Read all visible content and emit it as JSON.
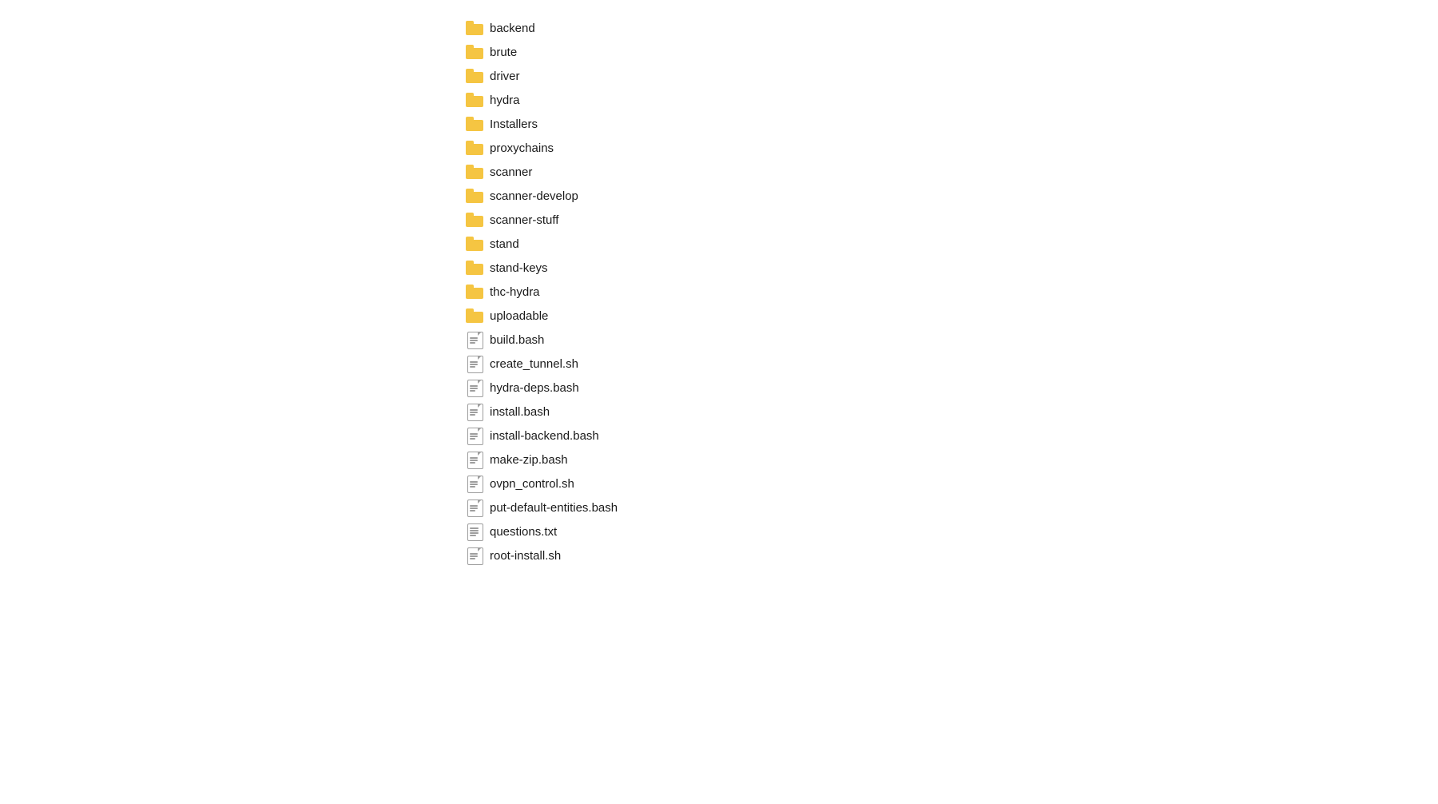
{
  "fileList": {
    "items": [
      {
        "name": "backend",
        "type": "folder"
      },
      {
        "name": "brute",
        "type": "folder"
      },
      {
        "name": "driver",
        "type": "folder"
      },
      {
        "name": "hydra",
        "type": "folder"
      },
      {
        "name": "Installers",
        "type": "folder"
      },
      {
        "name": "proxychains",
        "type": "folder"
      },
      {
        "name": "scanner",
        "type": "folder"
      },
      {
        "name": "scanner-develop",
        "type": "folder"
      },
      {
        "name": "scanner-stuff",
        "type": "folder"
      },
      {
        "name": "stand",
        "type": "folder"
      },
      {
        "name": "stand-keys",
        "type": "folder"
      },
      {
        "name": "thc-hydra",
        "type": "folder"
      },
      {
        "name": "uploadable",
        "type": "folder"
      },
      {
        "name": "build.bash",
        "type": "file"
      },
      {
        "name": "create_tunnel.sh",
        "type": "file"
      },
      {
        "name": "hydra-deps.bash",
        "type": "file"
      },
      {
        "name": "install.bash",
        "type": "file"
      },
      {
        "name": "install-backend.bash",
        "type": "file"
      },
      {
        "name": "make-zip.bash",
        "type": "file"
      },
      {
        "name": "ovpn_control.sh",
        "type": "file"
      },
      {
        "name": "put-default-entities.bash",
        "type": "file"
      },
      {
        "name": "questions.txt",
        "type": "txt"
      },
      {
        "name": "root-install.sh",
        "type": "file"
      }
    ]
  }
}
